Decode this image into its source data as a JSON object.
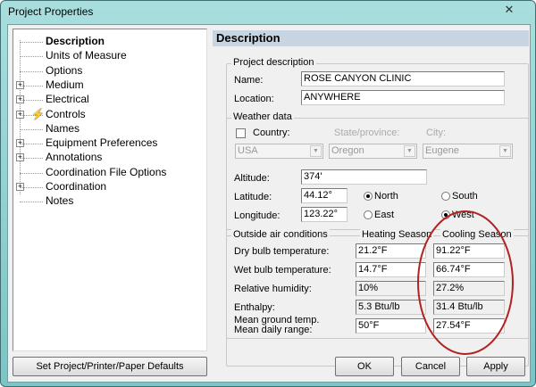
{
  "window": {
    "title": "Project Properties",
    "close": "✕"
  },
  "tree": {
    "items": [
      {
        "label": "Description",
        "expandable": false,
        "selected": true
      },
      {
        "label": "Units of Measure",
        "expandable": false
      },
      {
        "label": "Options",
        "expandable": false
      },
      {
        "label": "Medium",
        "expandable": true
      },
      {
        "label": "Electrical",
        "expandable": true
      },
      {
        "label": "Controls",
        "expandable": true,
        "icon": "lightning-icon"
      },
      {
        "label": "Names",
        "expandable": false
      },
      {
        "label": "Equipment Preferences",
        "expandable": true
      },
      {
        "label": "Annotations",
        "expandable": true
      },
      {
        "label": "Coordination File Options",
        "expandable": false
      },
      {
        "label": "Coordination",
        "expandable": true
      },
      {
        "label": "Notes",
        "expandable": false
      }
    ]
  },
  "panel": {
    "header": "Description",
    "project": {
      "legend": "Project description",
      "name_label": "Name:",
      "name": "ROSE CANYON CLINIC",
      "location_label": "Location:",
      "location": "ANYWHERE"
    },
    "weather": {
      "legend": "Weather data",
      "country_label": "Country:",
      "state_label": "State/province:",
      "city_label": "City:",
      "country": "USA",
      "state": "Oregon",
      "city": "Eugene",
      "altitude_label": "Altitude:",
      "altitude": "374'",
      "latitude_label": "Latitude:",
      "latitude": "44.12°",
      "longitude_label": "Longitude:",
      "longitude": "123.22°",
      "north": "North",
      "south": "South",
      "east": "East",
      "west": "West"
    },
    "outside": {
      "legend": "Outside air conditions",
      "heating": "Heating Season",
      "cooling": "Cooling Season",
      "rows": [
        {
          "label": "Dry bulb temperature:",
          "heating": "21.2°F",
          "cooling": "91.22°F"
        },
        {
          "label": "Wet bulb temperature:",
          "heating": "14.7°F",
          "cooling": "66.74°F"
        },
        {
          "label": "Relative humidity:",
          "heating": "10%",
          "cooling": "27.2%"
        },
        {
          "label": "Enthalpy:",
          "heating": "5.3 Btu/lb",
          "cooling": "31.4 Btu/lb"
        },
        {
          "label": "Mean ground temp.",
          "label2": "Mean daily range:",
          "heating": "50°F",
          "cooling": "27.54°F"
        }
      ]
    }
  },
  "buttons": {
    "defaults": "Set Project/Printer/Paper Defaults",
    "ok": "OK",
    "cancel": "Cancel",
    "apply": "Apply"
  },
  "colors": {
    "annotation": "#b22222",
    "header": "#c7d4e2"
  }
}
